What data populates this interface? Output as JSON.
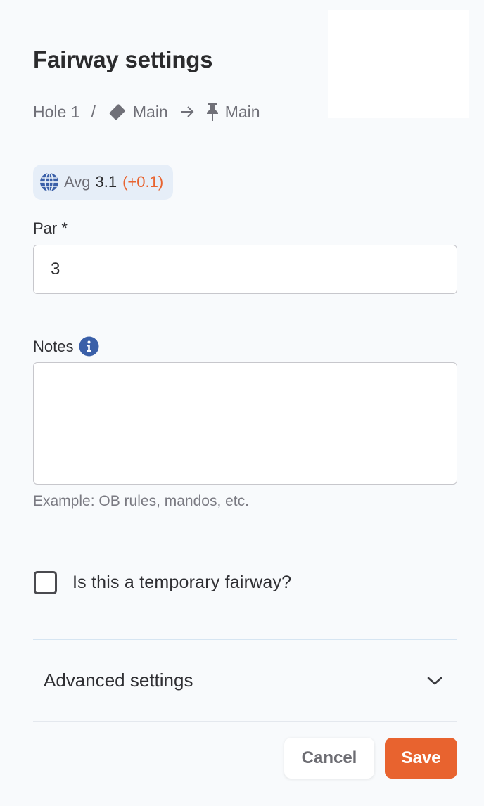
{
  "dialog": {
    "title": "Fairway settings"
  },
  "breadcrumb": {
    "hole": "Hole 1",
    "separator": "/",
    "tee_icon": "tag-icon",
    "tee_label": "Main",
    "arrow_icon": "arrow-right-icon",
    "target_icon": "pin-icon",
    "target_label": "Main"
  },
  "average": {
    "icon": "globe-icon",
    "label": "Avg",
    "value": "3.1",
    "delta": "(+0.1)",
    "delta_color": "#e8632f"
  },
  "par": {
    "label": "Par *",
    "value": "3"
  },
  "notes": {
    "label": "Notes",
    "info_icon": "info-icon",
    "value": "",
    "helper": "Example: OB rules, mandos, etc."
  },
  "temporary": {
    "label": "Is this a temporary fairway?",
    "checked": false
  },
  "advanced": {
    "label": "Advanced settings",
    "icon": "chevron-down-icon"
  },
  "actions": {
    "cancel": "Cancel",
    "save": "Save",
    "accent_color": "#e8632f"
  }
}
